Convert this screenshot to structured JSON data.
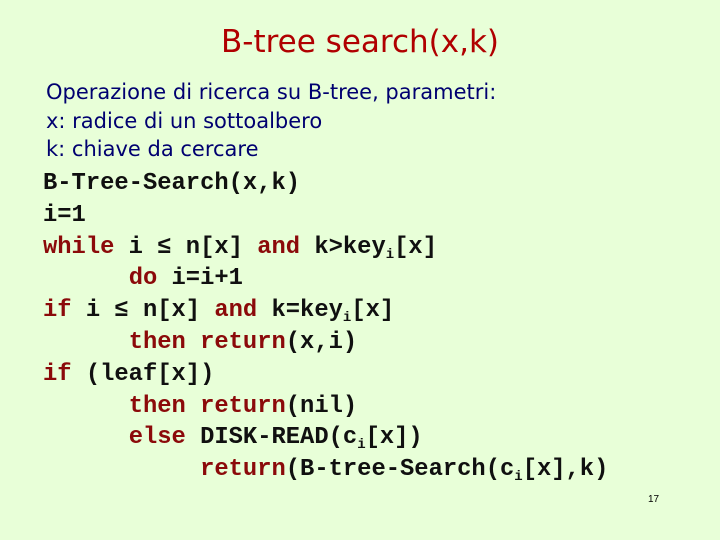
{
  "slide": {
    "title": "B-tree search(x,k)",
    "page_number": "17",
    "colors": {
      "background": "#E8FFD8",
      "title": "#B00000",
      "description": "#000070",
      "keyword": "#8B0A0A",
      "code": "#101010"
    }
  },
  "description": {
    "lines": [
      "Operazione di ricerca su B-tree, parametri:",
      "x: radice di un sottoalbero",
      "k: chiave da cercare"
    ]
  },
  "code": {
    "line1": {
      "text": "B-Tree-Search(x,k)"
    },
    "line2": {
      "text": "i=1"
    },
    "line3": {
      "kw1": "while",
      "t1": " i ≤ n[x] ",
      "kw2": "and",
      "t2": " k>key",
      "sub": "i",
      "t3": "[x]"
    },
    "line4": {
      "indent": "      ",
      "kw1": "do",
      "t1": " i=i+1"
    },
    "line5": {
      "kw1": "if",
      "t1": " i ≤ n[x] ",
      "kw2": "and",
      "t2": " k=key",
      "sub": "i",
      "t3": "[x]"
    },
    "line6": {
      "indent": "      ",
      "kw1": "then",
      "t0": " ",
      "kw2": "return",
      "t1": "(x,i)"
    },
    "line7": {
      "kw1": "if",
      "t1": " (leaf[x])"
    },
    "line8": {
      "indent": "      ",
      "kw1": "then",
      "t0": " ",
      "kw2": "return",
      "t1": "(nil)"
    },
    "line9": {
      "indent": "      ",
      "kw1": "else",
      "t1": " DISK-READ(c",
      "sub": "i",
      "t2": "[x])"
    },
    "line10": {
      "indent": "           ",
      "kw1": "return",
      "t1": "(B-tree-Search(c",
      "sub": "i",
      "t2": "[x],k)"
    }
  }
}
